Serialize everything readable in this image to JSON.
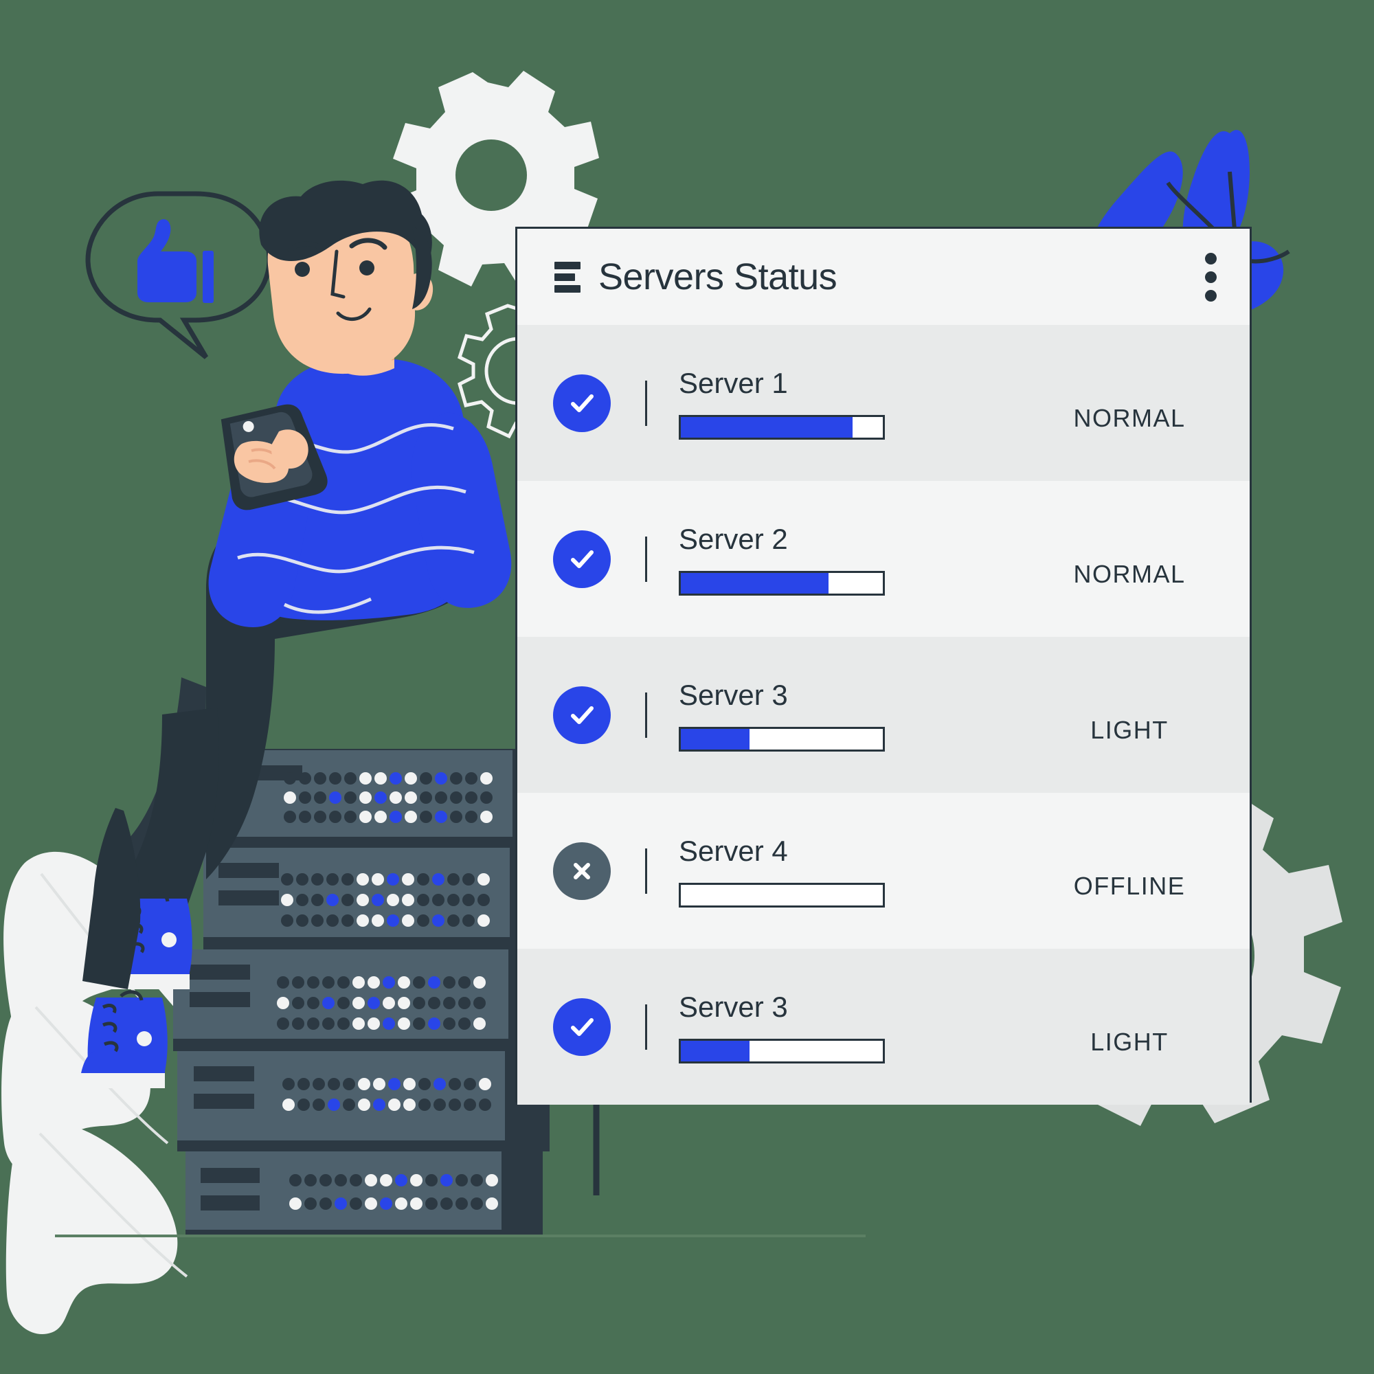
{
  "scene": {
    "background_color": "#4a7055",
    "description": "Flat illustration: man sitting on a server rack holding a tablet, connected by cables to a Servers Status panel",
    "accent_blue": "#2945e8",
    "dark_slate": "#27343d",
    "panel_bg": "#f4f5f5",
    "row_shade": "#e8eaea",
    "gear_gray": "#e0e2e2",
    "leaf_white": "#f2f3f3",
    "skin": "#f9c6a3",
    "rack_body": "#4e616d"
  },
  "card": {
    "header": {
      "menu_icon": "hamburger-icon",
      "title": "Servers Status",
      "overflow_icon": "kebab-menu-icon"
    },
    "columns": [
      "status",
      "name",
      "load",
      "label"
    ],
    "rows": [
      {
        "name": "Server 1",
        "status_icon": "check-circle-icon",
        "status_color": "#2945e8",
        "load_percent": 85,
        "label": "NORMAL",
        "shade": "shade-a"
      },
      {
        "name": "Server 2",
        "status_icon": "check-circle-icon",
        "status_color": "#2945e8",
        "load_percent": 73,
        "label": "NORMAL",
        "shade": "shade-b"
      },
      {
        "name": "Server 3",
        "status_icon": "check-circle-icon",
        "status_color": "#2945e8",
        "load_percent": 34,
        "label": "LIGHT",
        "shade": "shade-a"
      },
      {
        "name": "Server 4",
        "status_icon": "x-circle-icon",
        "status_color": "#4e616d",
        "load_percent": 0,
        "label": "OFFLINE",
        "shade": "shade-b"
      },
      {
        "name": "Server 3",
        "status_icon": "check-circle-icon",
        "status_color": "#2945e8",
        "load_percent": 34,
        "label": "LIGHT",
        "shade": "shade-a"
      }
    ]
  },
  "decor": {
    "speech_bubble_icon": "thumbs-up-icon",
    "gear_large_icon": "gear-icon",
    "gear_small_icon": "gear-outline-icon",
    "gear_corner_icon": "gear-icon",
    "plant_icon": "leaf-sprig-icon",
    "leaves_icon": "monstera-leaf-icon",
    "tablet_icon": "tablet-device-icon",
    "rack_units": 5
  }
}
